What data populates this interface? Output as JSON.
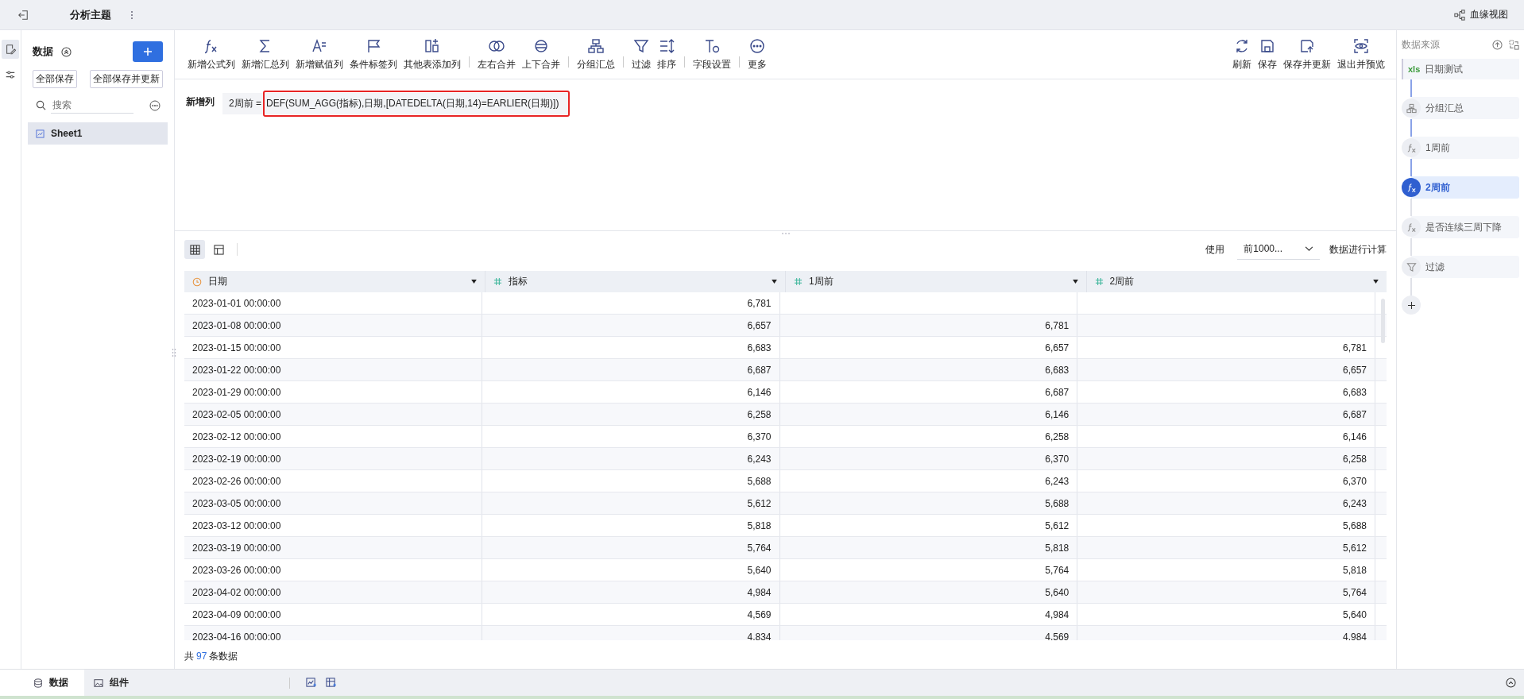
{
  "top_bar": {
    "title": "分析主题",
    "lineage_button": "血缘视图"
  },
  "side_rail": [
    {
      "selected": true
    },
    {
      "selected": false
    }
  ],
  "data_panel": {
    "title": "数据",
    "buttons": [
      "全部保存",
      "全部保存并更新"
    ],
    "search": {
      "placeholder": "搜索"
    },
    "sheets": [
      {
        "label": "Sheet1",
        "selected": true
      }
    ]
  },
  "toolbar": {
    "groups": [
      [
        "新增公式列",
        "新增汇总列",
        "新增赋值列",
        "条件标签列",
        "其他表添加列"
      ],
      [
        "左右合并",
        "上下合并"
      ],
      [
        "分组汇总"
      ],
      [
        "过滤",
        "排序"
      ],
      [
        "字段设置"
      ],
      [
        "更多"
      ]
    ],
    "right": [
      "刷新",
      "保存",
      "保存并更新",
      "退出并预览"
    ]
  },
  "formula": {
    "label": "新增列",
    "name": "2周前 =",
    "expression": "DEF(SUM_AGG(指标),日期,[DATEDELTA(日期,14)=EARLIER(日期)])",
    "highlighted": true
  },
  "table_view": {
    "views": [
      {
        "selected": true
      },
      {
        "selected": false
      }
    ],
    "use_label": "使用",
    "row_limit": "前1000...",
    "calc_label": "数据进行计算"
  },
  "table": {
    "columns": [
      {
        "label": "日期",
        "kind": "date"
      },
      {
        "label": "指标",
        "kind": "number"
      },
      {
        "label": "1周前",
        "kind": "number"
      },
      {
        "label": "2周前",
        "kind": "number"
      }
    ],
    "rows": [
      [
        "2023-01-01 00:00:00",
        "6,781",
        null,
        null
      ],
      [
        "2023-01-08 00:00:00",
        "6,657",
        "6,781",
        null
      ],
      [
        "2023-01-15 00:00:00",
        "6,683",
        "6,657",
        "6,781"
      ],
      [
        "2023-01-22 00:00:00",
        "6,687",
        "6,683",
        "6,657"
      ],
      [
        "2023-01-29 00:00:00",
        "6,146",
        "6,687",
        "6,683"
      ],
      [
        "2023-02-05 00:00:00",
        "6,258",
        "6,146",
        "6,687"
      ],
      [
        "2023-02-12 00:00:00",
        "6,370",
        "6,258",
        "6,146"
      ],
      [
        "2023-02-19 00:00:00",
        "6,243",
        "6,370",
        "6,258"
      ],
      [
        "2023-02-26 00:00:00",
        "5,688",
        "6,243",
        "6,370"
      ],
      [
        "2023-03-05 00:00:00",
        "5,612",
        "5,688",
        "6,243"
      ],
      [
        "2023-03-12 00:00:00",
        "5,818",
        "5,612",
        "5,688"
      ],
      [
        "2023-03-19 00:00:00",
        "5,764",
        "5,818",
        "5,612"
      ],
      [
        "2023-03-26 00:00:00",
        "5,640",
        "5,764",
        "5,818"
      ],
      [
        "2023-04-02 00:00:00",
        "4,984",
        "5,640",
        "5,764"
      ],
      [
        "2023-04-09 00:00:00",
        "4,569",
        "4,984",
        "5,640"
      ],
      [
        "2023-04-16 00:00:00",
        "4,834",
        "4,569",
        "4,984"
      ]
    ],
    "footer": {
      "prefix": "共",
      "count": "97",
      "suffix": "条数据"
    }
  },
  "source_panel": {
    "title": "数据来源",
    "steps": [
      {
        "kind": "source",
        "label": "日期测试",
        "badge": "xls",
        "selected": false
      },
      {
        "kind": "group",
        "label": "分组汇总",
        "selected": false
      },
      {
        "kind": "formula",
        "label": "1周前",
        "selected": false
      },
      {
        "kind": "formula",
        "label": "2周前",
        "selected": true
      },
      {
        "kind": "formula",
        "label": "是否连续三周下降",
        "selected": false
      },
      {
        "kind": "filter",
        "label": "过滤",
        "selected": false
      }
    ]
  },
  "bottom_tabs": [
    {
      "label": "数据",
      "selected": true
    },
    {
      "label": "组件",
      "selected": false
    }
  ]
}
